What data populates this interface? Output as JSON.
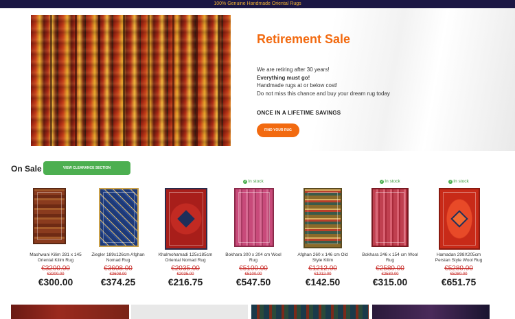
{
  "topbar": {
    "text": "100% Genuine Handmade Oriental Rugs"
  },
  "hero": {
    "title": "Retirement Sale",
    "line1": "We are retiring after 30 years!",
    "line2": "Everything must go!",
    "line3": "Handmade rugs at or below cost!",
    "line4": "Do not miss this chance and buy your dream rug today",
    "strap": "ONCE IN A LIFETIME SAVINGS",
    "button": "FIND YOUR RUG"
  },
  "sale": {
    "heading": "On Sale",
    "clearance_button": "VIEW CLEARANCE SECTION"
  },
  "products": [
    {
      "name": "Mashwani Kilim 281 x 145 Oriental Kilim Rug",
      "stock": "",
      "old_price": "€3200.00",
      "old_price2": "€3200.00",
      "price": "€300.00"
    },
    {
      "name": "Ziegler 189x126cm Afghan Nomad Rug",
      "stock": "",
      "old_price": "€3608.00",
      "old_price2": "€3608.00",
      "price": "€374.25"
    },
    {
      "name": "Khalmohamadi 125x185cm Oriental Nomad Rug",
      "stock": "",
      "old_price": "€2035.00",
      "old_price2": "€2035.00",
      "price": "€216.75"
    },
    {
      "name": "Bokhara 300 x 204 cm Wool Rug",
      "stock": "In stock",
      "old_price": "€5100.00",
      "old_price2": "€5100.00",
      "price": "€547.50"
    },
    {
      "name": "Afghan 260 x 146 cm Old Style Kilim",
      "stock": "",
      "old_price": "€1212.00",
      "old_price2": "€1212.00",
      "price": "€142.50"
    },
    {
      "name": "Bokhara 246 x 154 cm Wool Rug",
      "stock": "In stock",
      "old_price": "€2580.00",
      "old_price2": "€2580.00",
      "price": "€315.00"
    },
    {
      "name": "Hamadan 298X205cm Persian Style Wool Rug",
      "stock": "In stock",
      "old_price": "€5280.00",
      "old_price2": "€5280.00",
      "price": "€651.75"
    }
  ],
  "colors": {
    "accent_orange": "#f26a10",
    "topbar_bg": "#1b1744",
    "topbar_text": "#f4b333",
    "clearance_green": "#4caf50",
    "sale_red": "#c9302c"
  }
}
